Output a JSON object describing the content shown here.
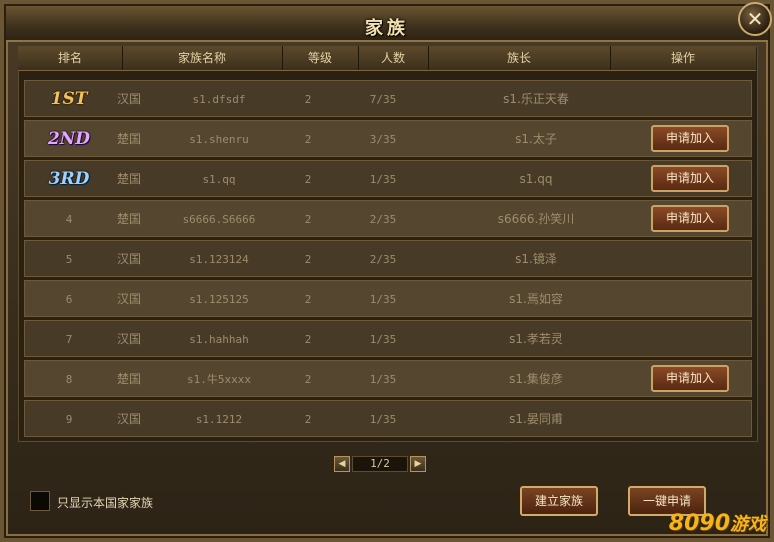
{
  "window": {
    "title": "家族",
    "close_label": "✕"
  },
  "table": {
    "headers": [
      "排名",
      "家族名称",
      "等级",
      "人数",
      "族长",
      "操作"
    ],
    "rows": [
      {
        "rank": "1ST",
        "nation": "汉国",
        "name": "s1.dfsdf",
        "level": "2",
        "members": "7/35",
        "leader": "s1.乐正天春",
        "action": ""
      },
      {
        "rank": "2ND",
        "nation": "楚国",
        "name": "s1.shenru",
        "level": "2",
        "members": "3/35",
        "leader": "s1.太子",
        "action": "申请加入"
      },
      {
        "rank": "3RD",
        "nation": "楚国",
        "name": "s1.qq",
        "level": "2",
        "members": "1/35",
        "leader": "s1.qq",
        "action": "申请加入"
      },
      {
        "rank": "4",
        "nation": "楚国",
        "name": "s6666.S6666",
        "level": "2",
        "members": "2/35",
        "leader": "s6666.孙笑川",
        "action": "申请加入"
      },
      {
        "rank": "5",
        "nation": "汉国",
        "name": "s1.123124",
        "level": "2",
        "members": "2/35",
        "leader": "s1.镜泽",
        "action": ""
      },
      {
        "rank": "6",
        "nation": "汉国",
        "name": "s1.125125",
        "level": "2",
        "members": "1/35",
        "leader": "s1.焉如容",
        "action": ""
      },
      {
        "rank": "7",
        "nation": "汉国",
        "name": "s1.hahhah",
        "level": "2",
        "members": "1/35",
        "leader": "s1.孝若灵",
        "action": ""
      },
      {
        "rank": "8",
        "nation": "楚国",
        "name": "s1.牛5xxxx",
        "level": "2",
        "members": "1/35",
        "leader": "s1.集俊彦",
        "action": "申请加入"
      },
      {
        "rank": "9",
        "nation": "汉国",
        "name": "s1.1212",
        "level": "2",
        "members": "1/35",
        "leader": "s1.晏同甫",
        "action": ""
      }
    ]
  },
  "pagination": {
    "prev": "◀",
    "next": "▶",
    "page": "1/2"
  },
  "footer": {
    "filter_label": "只显示本国家家族",
    "create_button": "建立家族",
    "apply_button": "一键申请"
  },
  "watermark": {
    "number": "8090",
    "text": "游戏"
  },
  "colors": {
    "frame": "#6b5634",
    "button": "#7a4422",
    "gold": "#f1c25a"
  }
}
